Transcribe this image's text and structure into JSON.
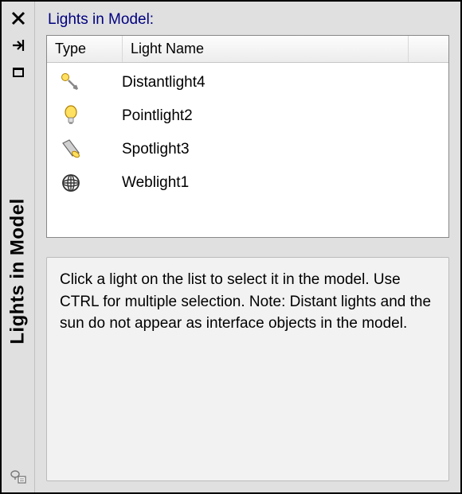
{
  "panel": {
    "sidebar_title": "Lights in Model",
    "title": "Lights in Model:"
  },
  "table": {
    "headers": {
      "type": "Type",
      "name": "Light Name"
    },
    "rows": [
      {
        "icon": "distant-light-icon",
        "name": "Distantlight4"
      },
      {
        "icon": "point-light-icon",
        "name": "Pointlight2"
      },
      {
        "icon": "spotlight-icon",
        "name": "Spotlight3"
      },
      {
        "icon": "web-light-icon",
        "name": "Weblight1"
      }
    ]
  },
  "info": {
    "text": "Click a light on the list to select it in the model. Use CTRL for multiple selection. Note: Distant lights and the sun do not appear as interface objects in the model."
  },
  "icons": {
    "close": "close-icon",
    "autohide": "autohide-icon",
    "menu": "menu-icon",
    "properties": "properties-icon"
  }
}
